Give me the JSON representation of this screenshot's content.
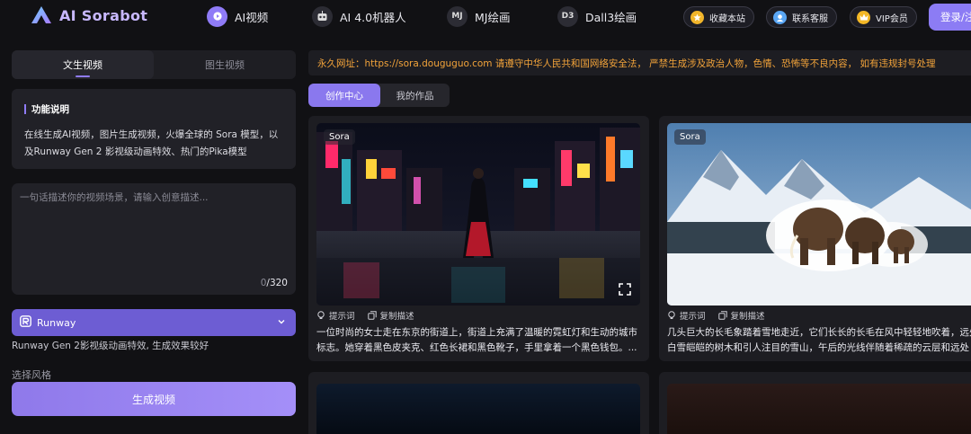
{
  "brand": {
    "name": "AI Sorabot"
  },
  "nav": {
    "items": [
      {
        "badge": "",
        "label": "AI视频",
        "icon": "play-icon"
      },
      {
        "badge": "",
        "label": "AI 4.0机器人",
        "icon": "robot-icon"
      },
      {
        "badge": "MJ",
        "label": "MJ绘画",
        "icon": "mj-badge-icon"
      },
      {
        "badge": "D3",
        "label": "Dall3绘画",
        "icon": "d3-badge-icon"
      }
    ],
    "bookmark_label": "收藏本站",
    "support_label": "联系客服",
    "vip_label": "VIP会员",
    "login_label": "登录/注"
  },
  "left": {
    "tabs": [
      "文生视频",
      "图生视频"
    ],
    "info": {
      "title": "功能说明",
      "text": "在线生成AI视频，图片生成视频，火爆全球的 Sora 模型，以及Runway Gen 2 影视级动画特效、热门的Pika模型"
    },
    "prompt": {
      "placeholder": "一句话描述你的视频场景，请输入创意描述...",
      "value": "",
      "count": "0",
      "max": "/320"
    },
    "model": {
      "label": "Runway",
      "desc": "Runway Gen 2影视级动画特效, 生成效果较好"
    },
    "style_label": "选择风格",
    "generate_label": "生成视频"
  },
  "right": {
    "notice": "永久网址：https://sora.douguguo.com 请遵守中华人民共和国网络安全法， 严禁生成涉及政治人物，色情、恐怖等不良内容， 如有违规封号处理",
    "sub_tabs": [
      "创作中心",
      "我的作品"
    ],
    "cards": [
      {
        "tag": "Sora",
        "hint_label": "提示词",
        "copy_label": "复制描述",
        "desc": "一位时尚的女士走在东京的街道上，街道上充满了温暖的霓虹灯和生动的城市标志。她穿着黑色皮夹克、红色长裙和黑色靴子，手里拿着一个黑色钱包。..."
      },
      {
        "tag": "Sora",
        "hint_label": "提示词",
        "copy_label": "复制描述",
        "desc": "几头巨大的长毛象踏着雪地走近，它们长长的长毛在风中轻轻地吹着，远处是白雪皑皑的树木和引人注目的雪山，午后的光线伴随着稀疏的云层和远处"
      }
    ]
  },
  "colors": {
    "accent": "#8f7bf7",
    "notice": "#f2a33a",
    "background": "#111114",
    "panel": "#212127"
  }
}
